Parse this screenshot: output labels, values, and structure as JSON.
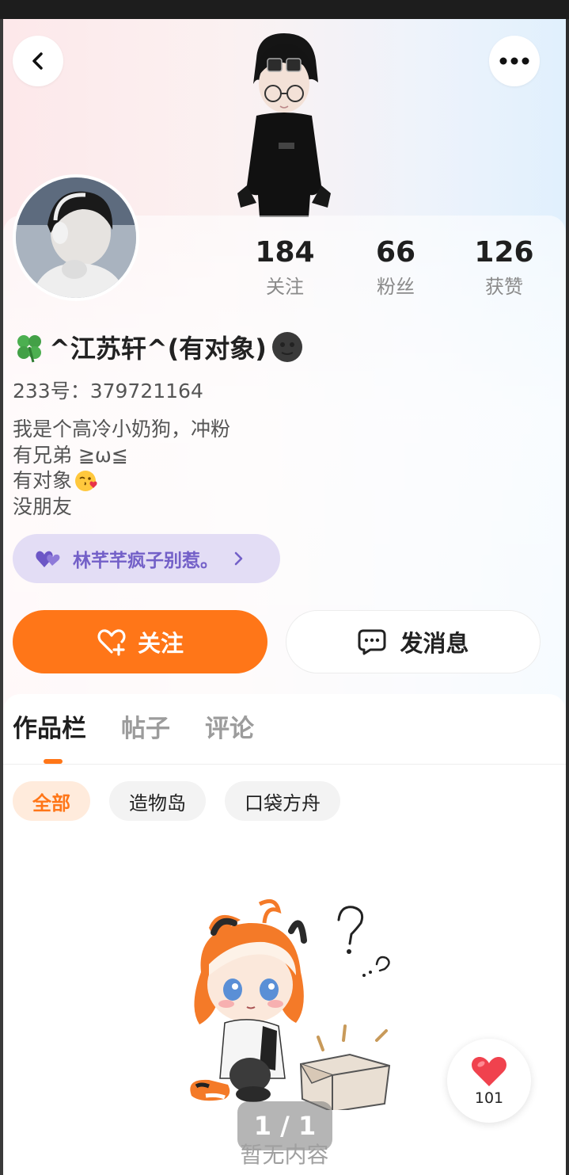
{
  "header": {
    "back_icon": "chevron-left-icon",
    "more_icon": "more-horizontal-icon"
  },
  "profile": {
    "nickname_prefix_icon": "four-leaf-clover-icon",
    "nickname": "^江苏轩^(有对象)",
    "nickname_suffix_icon": "dark-moon-face-icon",
    "uid": "233号：379721164",
    "bio": [
      "我是个高冷小奶狗，冲粉",
      "有兄弟 ≧ω≦",
      "有对象",
      "没朋友"
    ],
    "bio_emoji": "kissing-heart-emoji",
    "stats": [
      {
        "value": "184",
        "label": "关注"
      },
      {
        "value": "66",
        "label": "粉丝"
      },
      {
        "value": "126",
        "label": "获赞"
      }
    ],
    "cp_link": {
      "icon": "double-heart-icon",
      "name": "林芊芊疯子别惹。",
      "chevron": "chevron-right-icon"
    }
  },
  "actions": {
    "follow_label": "关注",
    "follow_icon": "heart-plus-icon",
    "message_label": "发消息",
    "message_icon": "chat-bubble-icon"
  },
  "tabs": [
    {
      "label": "作品栏",
      "active": true
    },
    {
      "label": "帖子",
      "active": false
    },
    {
      "label": "评论",
      "active": false
    }
  ],
  "filters": [
    {
      "label": "全部",
      "active": true
    },
    {
      "label": "造物岛",
      "active": false
    },
    {
      "label": "口袋方舟",
      "active": false
    }
  ],
  "empty": {
    "text": "暂无内容",
    "page_indicator": "1 / 1"
  },
  "like_fab": {
    "icon": "heart-icon",
    "count": "101"
  },
  "colors": {
    "accent": "#ff7618",
    "cp_pill_bg": "#e3ddf5",
    "cp_text": "#7360c8"
  }
}
